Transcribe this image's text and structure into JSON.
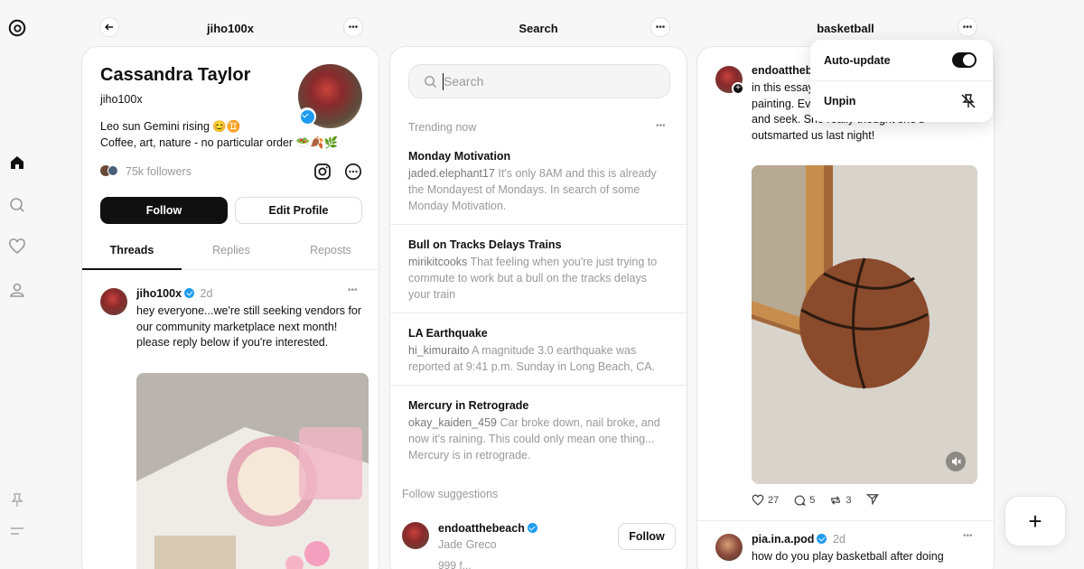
{
  "colors": {
    "accent": "#101010",
    "verified": "#1d9bf0",
    "muted": "#999999"
  },
  "rail": {
    "icons": [
      "threads-logo-icon",
      "home-icon",
      "search-icon",
      "heart-icon",
      "profile-icon",
      "pin-icon",
      "menu-icon"
    ]
  },
  "profile_col": {
    "header_title": "jiho100x",
    "name": "Cassandra Taylor",
    "handle": "jiho100x",
    "bio_line1": "Leo sun Gemini rising 😊♊",
    "bio_line2": "Coffee, art, nature - no particular order 🥗🍂🌿",
    "followers": "75k followers",
    "follow_label": "Follow",
    "edit_label": "Edit Profile",
    "tabs": [
      "Threads",
      "Replies",
      "Reposts"
    ],
    "post": {
      "author": "jiho100x",
      "time": "2d",
      "text": "hey everyone...we're still seeking vendors for our community marketplace next month! please reply below if you're interested."
    }
  },
  "search_col": {
    "header_title": "Search",
    "search_placeholder": "Search",
    "trending_label": "Trending now",
    "trends": [
      {
        "title": "Monday Motivation",
        "user": "jaded.elephant17",
        "text": " It's only 8AM and this is already the Mondayest of Mondays. In search of some Monday Motivation."
      },
      {
        "title": "Bull on Tracks Delays Trains",
        "user": "mirikitcooks",
        "text": " That feeling when you're just trying to commute to work but a bull on the tracks delays your train"
      },
      {
        "title": "LA Earthquake",
        "user": "hi_kimuraito",
        "text": " A magnitude 3.0 earthquake was reported at 9:41 p.m. Sunday in Long Beach, CA."
      },
      {
        "title": "Mercury in Retrograde",
        "user": "okay_kaiden_459",
        "text": " Car broke down, nail broke, and now it's raining. This could only mean one thing... Mercury is in retrograde."
      }
    ],
    "suggestions_label": "Follow suggestions",
    "suggestion": {
      "handle": "endoatthebeach",
      "name": "Jade Greco",
      "follow_label": "Follow",
      "followers_partial": "999 f..."
    }
  },
  "basket_col": {
    "header_title": "basketball",
    "post1": {
      "author": "endoatthebe",
      "text": "in this essay... daughter's ... behind this painting. Every night, she likes to play hide and seek. She really thought she'd outsmarted us last night!",
      "likes": "27",
      "replies": "5",
      "reposts": "3"
    },
    "post2": {
      "author": "pia.in.a.pod",
      "time": "2d",
      "text": "how do you play basketball after doing"
    }
  },
  "popup": {
    "auto_update_label": "Auto-update",
    "unpin_label": "Unpin"
  },
  "fab_label": "+"
}
